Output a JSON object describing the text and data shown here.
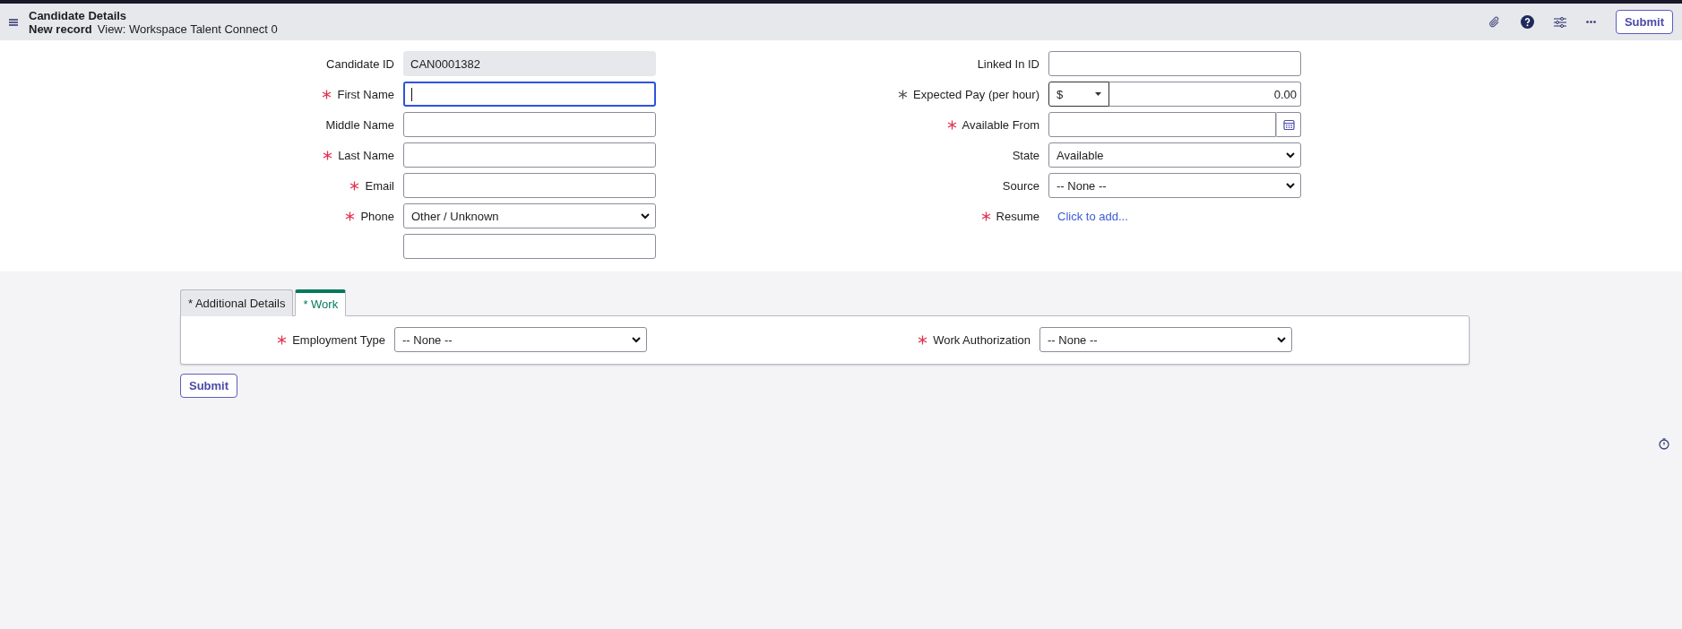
{
  "header": {
    "title": "Candidate Details",
    "subtitle": "New record",
    "view": "View: Workspace Talent Connect 0",
    "submit": "Submit"
  },
  "form": {
    "left": [
      {
        "kind": "readonly",
        "label": "Candidate ID",
        "value": "CAN0001382",
        "required": false,
        "focused": false
      },
      {
        "kind": "text",
        "label": "First Name",
        "required": true,
        "met": false,
        "focused": true
      },
      {
        "kind": "text",
        "label": "Middle Name",
        "required": false,
        "focused": false
      },
      {
        "kind": "text",
        "label": "Last Name",
        "required": true,
        "met": false,
        "focused": false
      },
      {
        "kind": "text",
        "label": "Email",
        "required": true,
        "met": false,
        "focused": false
      },
      {
        "kind": "select",
        "label": "Phone",
        "value": "Other / Unknown",
        "required": true,
        "met": false,
        "focused": false
      },
      {
        "kind": "text",
        "required": false,
        "focused": false
      }
    ],
    "right": [
      {
        "kind": "text",
        "label": "Linked In ID",
        "required": false,
        "focused": false
      },
      {
        "kind": "currency",
        "label": "Expected Pay (per hour)",
        "currency": "$",
        "value": "0.00",
        "required": true,
        "met": true,
        "focused": false
      },
      {
        "kind": "date",
        "label": "Available From",
        "required": true,
        "met": false,
        "focused": false
      },
      {
        "kind": "select",
        "label": "State",
        "value": "Available",
        "required": false,
        "focused": false
      },
      {
        "kind": "select",
        "label": "Source",
        "value": "-- None --",
        "required": false,
        "focused": false
      },
      {
        "kind": "link",
        "label": "Resume",
        "value": "Click to add...",
        "required": true,
        "met": false,
        "focused": false
      }
    ]
  },
  "tabs": [
    {
      "label": "* Additional Details",
      "selected": false
    },
    {
      "label": "* Work",
      "selected": true
    }
  ],
  "tab_panel": {
    "left": [
      {
        "kind": "select",
        "label": "Employment Type",
        "value": "-- None --",
        "required": true,
        "met": false,
        "focused": false
      }
    ],
    "right": [
      {
        "kind": "select",
        "label": "Work Authorization",
        "value": "-- None --",
        "required": true,
        "met": false,
        "focused": false
      }
    ]
  },
  "footer": {
    "submit": "Submit"
  }
}
